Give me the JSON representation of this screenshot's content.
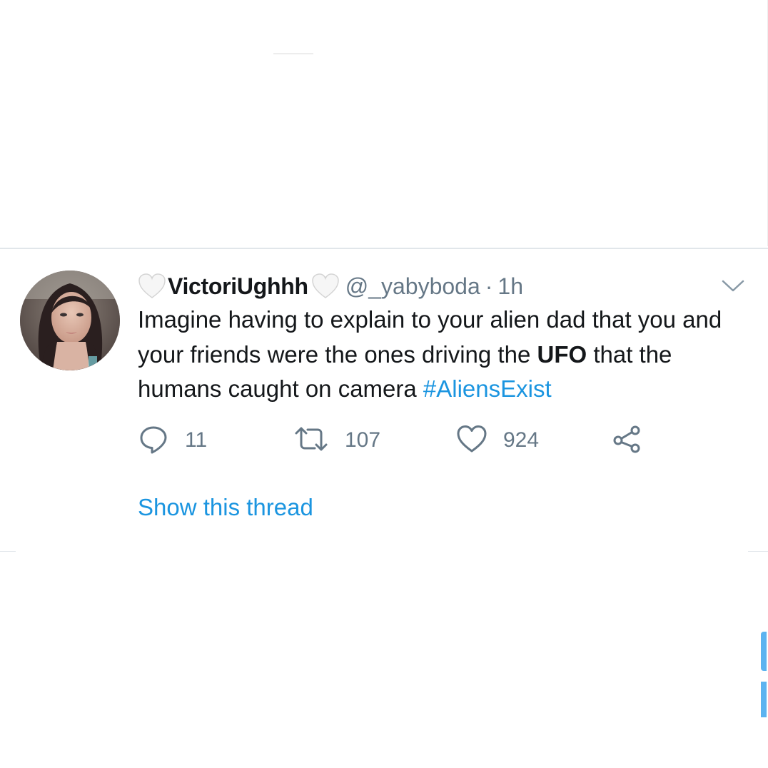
{
  "tweet": {
    "display_name": "VictoriUghhh",
    "handle": "@_yabyboda",
    "separator": "·",
    "time": "1h",
    "text_part1": "Imagine having to explain to your alien dad that you and your friends were the ones driving the ",
    "text_bold": "UFO",
    "text_part2": " that the humans caught on camera ",
    "hashtag": "#AliensExist",
    "heart_emoji_icon": "white-heart-icon"
  },
  "actions": {
    "reply": {
      "icon": "reply-icon",
      "count": "11"
    },
    "retweet": {
      "icon": "retweet-icon",
      "count": "107"
    },
    "like": {
      "icon": "like-heart-icon",
      "count": "924"
    },
    "share": {
      "icon": "share-icon"
    }
  },
  "show_thread_label": "Show this thread",
  "colors": {
    "text_primary": "#14171a",
    "text_secondary": "#657786",
    "link_blue": "#1b95e0",
    "divider": "#e1e6ea"
  }
}
